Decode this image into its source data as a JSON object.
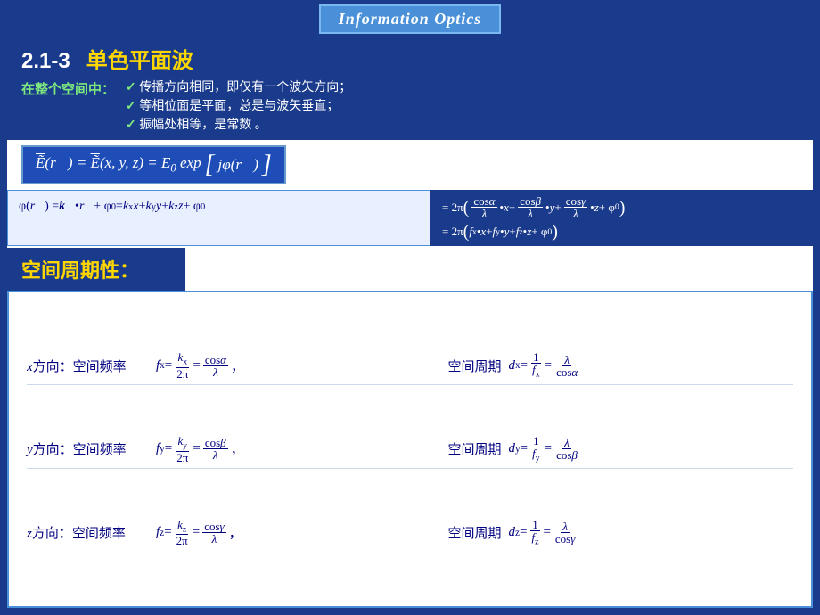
{
  "header": {
    "title": "Information Optics",
    "bg_color": "#4a90d9"
  },
  "section": {
    "number": "2.1-3",
    "title": "单色平面波",
    "subtitle_label": "在整个空间中：",
    "checkmarks": [
      "传播方向相同，即仅有一个波矢方向；",
      "等相位面是平面，总是与波矢垂直；",
      "振幅处相等，是常数 。"
    ]
  },
  "formula_e": "Ẽ(r⃗) = Ẽ(x,y,z) = E₀ exp[ jφ(r⃗) ]",
  "formula_phi_lhs": "φ(r⃗) = k⃗•r⃗ + φ₀ = kₓx + k_y y + k_z z + φ₀",
  "formula_phi_rhs1": "= 2π( cosα/λ •x + cosβ/λ •y + cosγ/λ •z + φ₀ )",
  "formula_phi_rhs2": "= 2π( fₓ•x + f_y•y + f_z•z + φ₀ )",
  "spatial_periodicity_label": "空间周期性：",
  "directions": [
    {
      "axis": "x",
      "label": "x方向：空间频率",
      "freq_lhs": "fₓ = kₓ / 2π = cosα / λ，",
      "period_label": "空间周期",
      "period_rhs": "dₓ = 1/fₓ = λ / cosα"
    },
    {
      "axis": "y",
      "label": "y方向：空间频率",
      "freq_lhs": "f_y = k_y / 2π = cosβ / λ，",
      "period_label": "空间周期",
      "period_rhs": "d_y = 1/f_y = λ / cosβ"
    },
    {
      "axis": "z",
      "label": "z方向：空间频率",
      "freq_lhs": "f_z = k_z / 2π = cosγ / λ，",
      "period_label": "空间周期",
      "period_rhs": "d_z = 1/f_z = λ / cosγ"
    }
  ]
}
